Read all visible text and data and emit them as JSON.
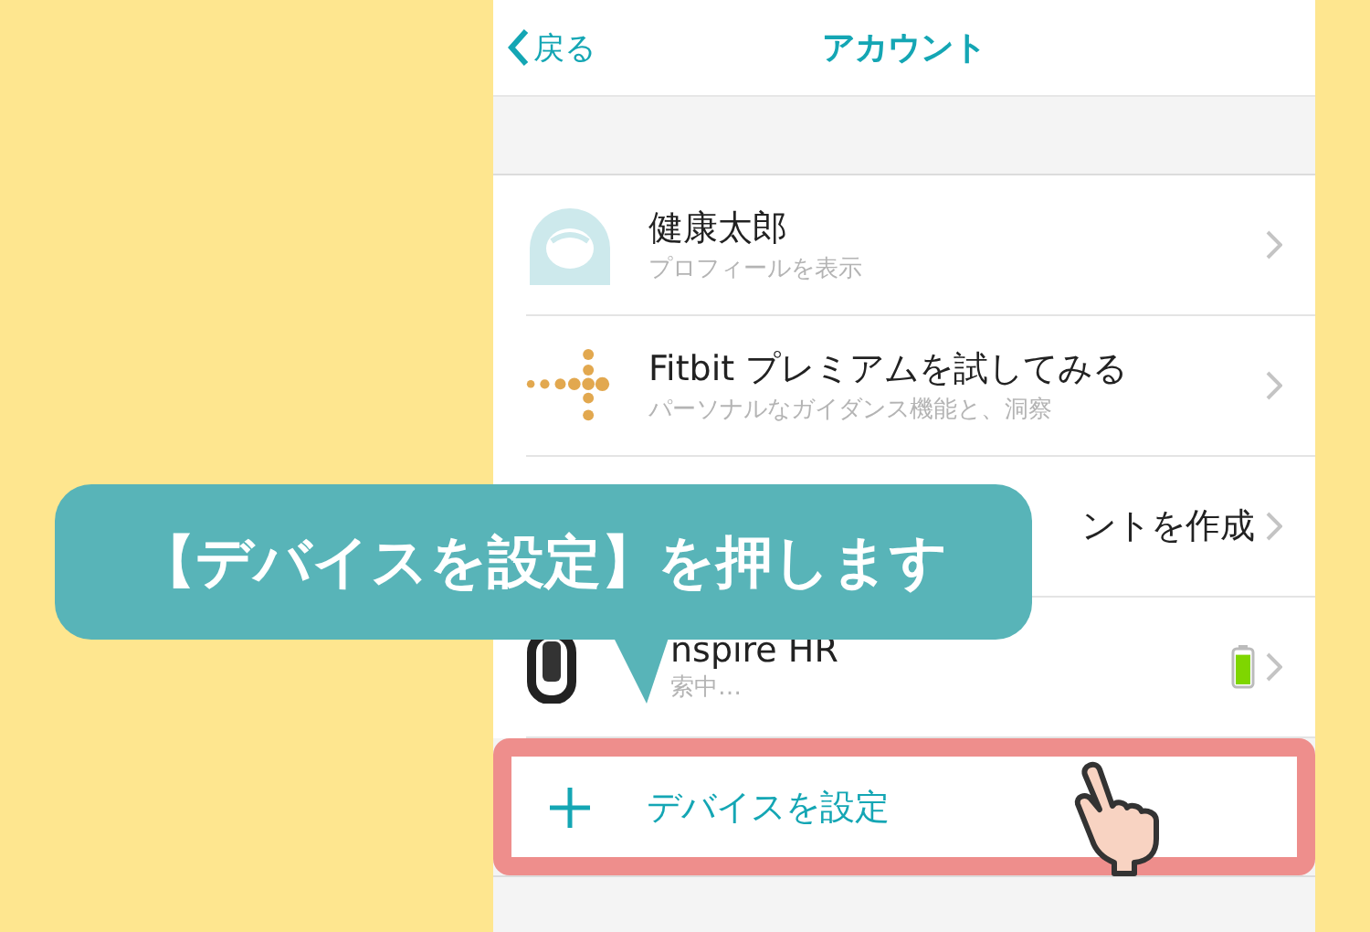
{
  "nav": {
    "back": "戻る",
    "title": "アカウント"
  },
  "rows": [
    {
      "kind": "profile",
      "title": "健康太郎",
      "subtitle": "プロフィールを表示"
    },
    {
      "kind": "premium",
      "title": "Fitbit プレミアムを試してみる",
      "subtitle": "パーソナルなガイダンス機能と、洞察"
    },
    {
      "kind": "clipped",
      "title": "ントを作成"
    },
    {
      "kind": "device",
      "title": "nspire HR",
      "subtitle": "索中…",
      "battery": {
        "level": 0.9
      }
    }
  ],
  "add_device": {
    "label": "デバイスを設定"
  },
  "callout": {
    "text": "【デバイスを設定】を押します"
  }
}
